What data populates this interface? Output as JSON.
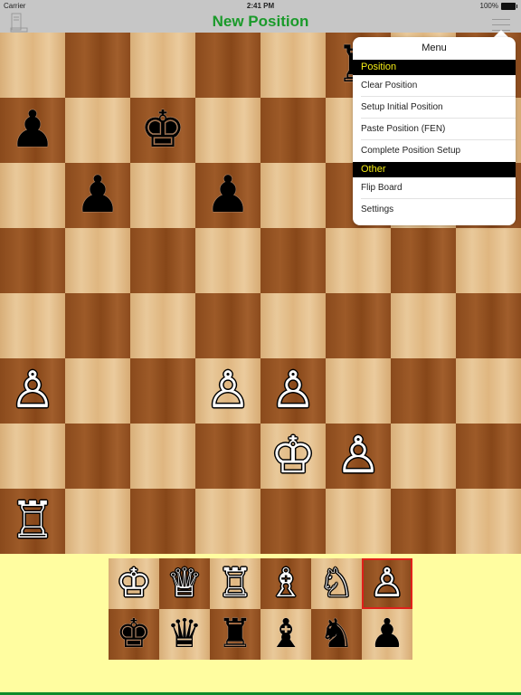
{
  "status_bar": {
    "carrier": "Carrier",
    "time": "2:41 PM",
    "battery": "100%"
  },
  "nav": {
    "title": "New Position",
    "left_icon": "book-icon",
    "right_icon": "hamburger-menu-icon"
  },
  "colors": {
    "title": "#1a9a2a",
    "section_text": "#f4ec16",
    "selected_border": "#e0201a",
    "bottom_bg": "#fffda0"
  },
  "board": {
    "orientation": "white-bottom",
    "pieces": [
      {
        "square": "f8",
        "piece": "rook",
        "color": "black",
        "glyph": "♜"
      },
      {
        "square": "a7",
        "piece": "pawn",
        "color": "black",
        "glyph": "♟"
      },
      {
        "square": "c7",
        "piece": "king",
        "color": "black",
        "glyph": "♚"
      },
      {
        "square": "b6",
        "piece": "pawn",
        "color": "black",
        "glyph": "♟"
      },
      {
        "square": "d6",
        "piece": "pawn",
        "color": "black",
        "glyph": "♟"
      },
      {
        "square": "a3",
        "piece": "pawn",
        "color": "white",
        "glyph": "♙"
      },
      {
        "square": "d3",
        "piece": "pawn",
        "color": "white",
        "glyph": "♙"
      },
      {
        "square": "e3",
        "piece": "pawn",
        "color": "white",
        "glyph": "♙"
      },
      {
        "square": "e2",
        "piece": "king",
        "color": "white",
        "glyph": "♔"
      },
      {
        "square": "f2",
        "piece": "pawn",
        "color": "white",
        "glyph": "♙"
      },
      {
        "square": "a1",
        "piece": "rook",
        "color": "white",
        "glyph": "♖"
      }
    ]
  },
  "palette": {
    "selected": "white-pawn",
    "rows": [
      [
        {
          "id": "white-king",
          "glyph": "♔",
          "color": "white"
        },
        {
          "id": "white-queen",
          "glyph": "♕",
          "color": "white"
        },
        {
          "id": "white-rook",
          "glyph": "♖",
          "color": "white"
        },
        {
          "id": "white-bishop",
          "glyph": "♗",
          "color": "white"
        },
        {
          "id": "white-knight",
          "glyph": "♘",
          "color": "white"
        },
        {
          "id": "white-pawn",
          "glyph": "♙",
          "color": "white"
        }
      ],
      [
        {
          "id": "black-king",
          "glyph": "♚",
          "color": "black"
        },
        {
          "id": "black-queen",
          "glyph": "♛",
          "color": "black"
        },
        {
          "id": "black-rook",
          "glyph": "♜",
          "color": "black"
        },
        {
          "id": "black-bishop",
          "glyph": "♝",
          "color": "black"
        },
        {
          "id": "black-knight",
          "glyph": "♞",
          "color": "black"
        },
        {
          "id": "black-pawn",
          "glyph": "♟",
          "color": "black"
        }
      ]
    ]
  },
  "menu": {
    "title": "Menu",
    "sections": [
      {
        "label": "Position",
        "items": [
          "Clear Position",
          "Setup Initial Position",
          "Paste Position (FEN)",
          "Complete Position Setup"
        ]
      },
      {
        "label": "Other",
        "items": [
          "Flip Board",
          "Settings"
        ]
      }
    ]
  }
}
